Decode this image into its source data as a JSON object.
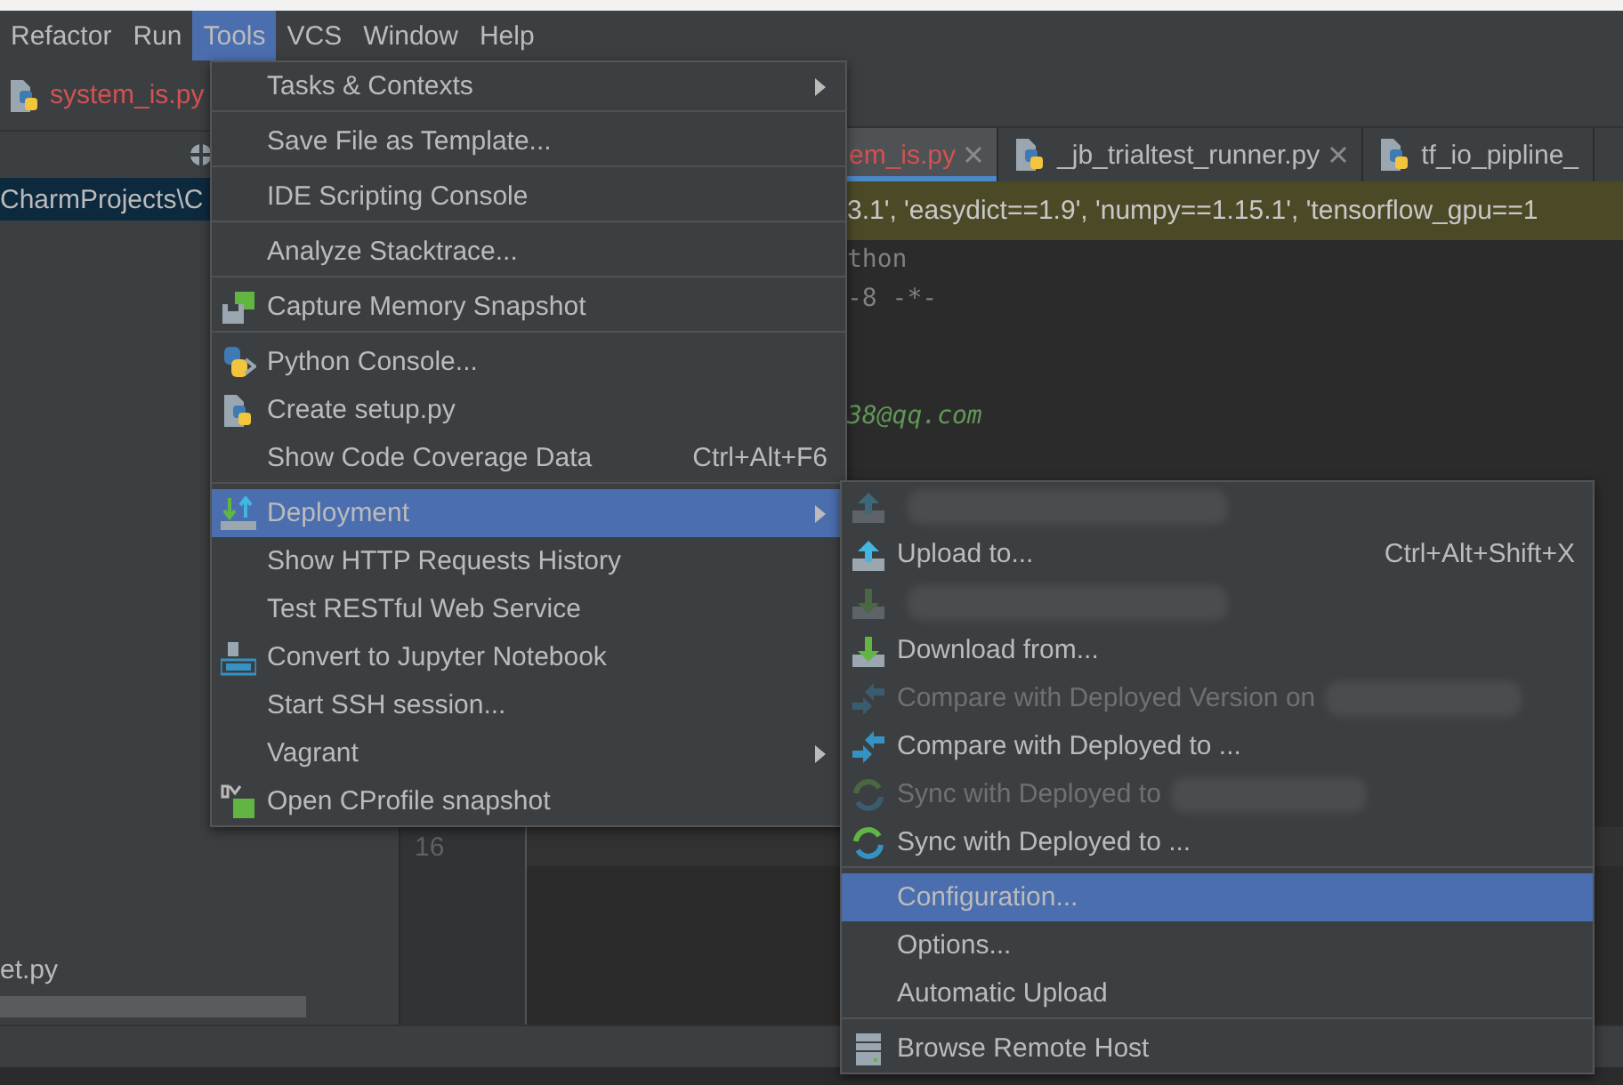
{
  "menubar": [
    {
      "label": "Refactor",
      "selected": false
    },
    {
      "label": "Run",
      "selected": false
    },
    {
      "label": "Tools",
      "selected": true
    },
    {
      "label": "VCS",
      "selected": false
    },
    {
      "label": "Window",
      "selected": false
    },
    {
      "label": "Help",
      "selected": false
    }
  ],
  "project_panel": {
    "file_tab": {
      "label": "system_is.py",
      "error": true
    },
    "path": "CharmProjects\\C",
    "file": "et.py"
  },
  "editor": {
    "tabs": [
      {
        "label": "em_is.py",
        "selected": true,
        "error": true
      },
      {
        "label": "_jb_trialtest_runner.py",
        "selected": false,
        "error": false
      },
      {
        "label": "tf_io_pipline_",
        "selected": false,
        "error": false
      }
    ],
    "notification": "3.1', 'easydict==1.9', 'numpy==1.15.1', 'tensorflow_gpu==1",
    "code_lines": [
      {
        "kind": "comment",
        "text": "thon"
      },
      {
        "kind": "comment",
        "text": "-8 -*-"
      },
      {
        "kind": "blank"
      },
      {
        "kind": "blank"
      },
      {
        "kind": "docstring",
        "text": "38@qq.com"
      }
    ],
    "current_line_number": "16"
  },
  "tools_menu": {
    "sections": [
      [
        {
          "label": "Tasks & Contexts",
          "submenu": true,
          "selected": false
        }
      ],
      [
        {
          "label": "Save File as Template...",
          "selected": false
        }
      ],
      [
        {
          "label": "IDE Scripting Console",
          "selected": false
        }
      ],
      [
        {
          "label": "Analyze Stacktrace...",
          "selected": false
        }
      ],
      [
        {
          "label": "Capture Memory Snapshot",
          "kind": "memory",
          "selected": false
        }
      ],
      [
        {
          "label": "Python Console...",
          "kind": "python",
          "selected": false
        },
        {
          "label": "Create setup.py",
          "kind": "pyfile",
          "selected": false
        },
        {
          "label": "Show Code Coverage Data",
          "shortcut": "Ctrl+Alt+F6",
          "selected": false
        }
      ],
      [
        {
          "label": "Deployment",
          "kind": "deploy",
          "submenu": true,
          "selected": true
        },
        {
          "label": "Show HTTP Requests History",
          "selected": false
        },
        {
          "label": "Test RESTful Web Service",
          "selected": false
        },
        {
          "label": "Convert to Jupyter Notebook",
          "kind": "jupyter",
          "selected": false
        },
        {
          "label": "Start SSH session...",
          "selected": false
        },
        {
          "label": "Vagrant",
          "submenu": true,
          "selected": false
        },
        {
          "label": "Open CProfile snapshot",
          "kind": "profile",
          "selected": false
        }
      ]
    ]
  },
  "deployment_menu": {
    "sections": [
      [
        {
          "kind": "upload",
          "redacted": true,
          "disabled": true,
          "selected": false
        },
        {
          "label": "Upload to...",
          "kind": "upload",
          "shortcut": "Ctrl+Alt+Shift+X",
          "selected": false
        },
        {
          "kind": "download",
          "redacted": true,
          "disabled": true,
          "selected": false
        },
        {
          "label": "Download from...",
          "kind": "download",
          "selected": false
        },
        {
          "label": "Compare with Deployed Version on",
          "kind": "compare",
          "redacted": true,
          "disabled": true,
          "selected": false
        },
        {
          "label": "Compare with Deployed to ...",
          "kind": "compare",
          "selected": false
        },
        {
          "label": "Sync with Deployed to",
          "kind": "sync",
          "redacted": true,
          "disabled": true,
          "selected": false
        },
        {
          "label": "Sync with Deployed to ...",
          "kind": "sync",
          "selected": false
        }
      ],
      [
        {
          "label": "Configuration...",
          "selected": true
        },
        {
          "label": "Options...",
          "selected": false
        },
        {
          "label": "Automatic Upload",
          "selected": false
        }
      ],
      [
        {
          "label": "Browse Remote Host",
          "kind": "server",
          "selected": false
        }
      ]
    ]
  }
}
